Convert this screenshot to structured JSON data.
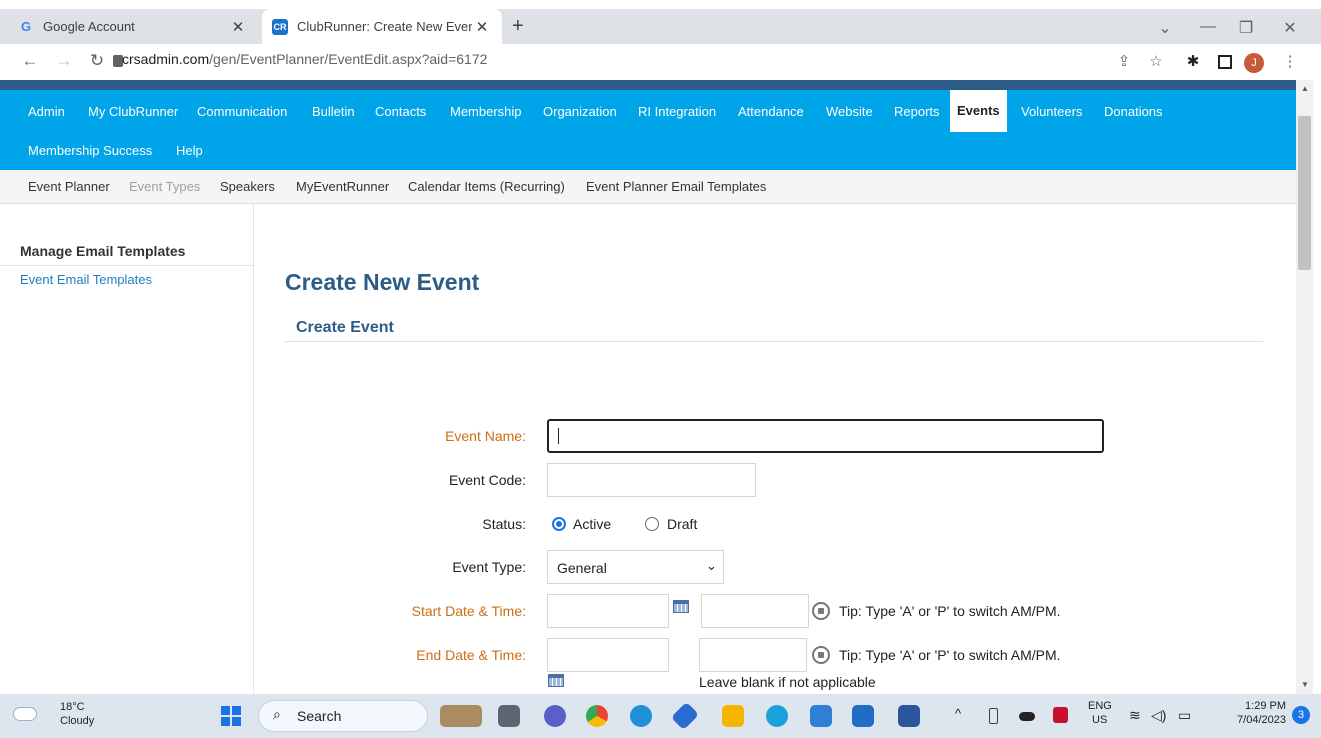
{
  "browser": {
    "tabs": [
      {
        "title": "Google Account",
        "favicon": "G",
        "active": false
      },
      {
        "title": "ClubRunner: Create New Event",
        "favicon": "CR",
        "active": true
      }
    ],
    "new_tab": "+",
    "url_host": "crsadmin.com",
    "url_path": "/gen/EventPlanner/EventEdit.aspx?aid=6172",
    "profile_initial": "J"
  },
  "nav": {
    "primary": [
      "Admin",
      "My ClubRunner",
      "Communication",
      "Bulletin",
      "Contacts",
      "Membership",
      "Organization",
      "RI Integration",
      "Attendance",
      "Website",
      "Reports",
      "Events",
      "Volunteers",
      "Donations"
    ],
    "active": "Events",
    "secondary_row": [
      "Membership Success",
      "Help"
    ],
    "sub": [
      "Event Planner",
      "Event Types",
      "Speakers",
      "MyEventRunner",
      "Calendar Items (Recurring)",
      "Event Planner Email Templates"
    ],
    "sub_muted": "Event Types"
  },
  "sidebar": {
    "heading": "Manage Email Templates",
    "links": [
      "Event Email Templates"
    ]
  },
  "main": {
    "title": "Create New Event",
    "section": "Create Event",
    "form": {
      "event_name_label": "Event Name:",
      "event_name_value": "",
      "event_code_label": "Event Code:",
      "status_label": "Status:",
      "status_options": [
        "Active",
        "Draft"
      ],
      "status_selected": "Active",
      "event_type_label": "Event Type:",
      "event_type_value": "General",
      "start_label": "Start Date & Time:",
      "end_label": "End Date & Time:",
      "tip": "Tip: Type 'A' or 'P' to switch AM/PM.",
      "leave_blank": "Leave blank if not applicable"
    },
    "colors": {
      "required_label": "#cc6e14",
      "nav_bg": "#00a4e8",
      "heading": "#2d5d86"
    }
  },
  "taskbar": {
    "weather_temp": "18°C",
    "weather_desc": "Cloudy",
    "search": "Search",
    "lang_top": "ENG",
    "lang_bottom": "US",
    "time": "1:29 PM",
    "date": "7/04/2023",
    "notifications": "3"
  }
}
